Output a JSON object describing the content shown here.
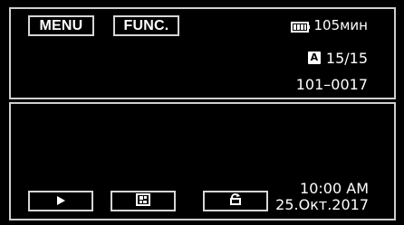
{
  "menu": {
    "label": "MENU"
  },
  "func": {
    "label": "FUNC."
  },
  "status": {
    "battery_icon": "battery-icon",
    "battery_time": "105мин",
    "mode_badge": "A",
    "count": "15/15",
    "file_number": "101–0017"
  },
  "controls": {
    "play_icon": "play-icon",
    "index_icon": "index-icon",
    "return_icon": "return-icon"
  },
  "datetime": {
    "time": "10:00 AM",
    "date": "25.Окт.2017"
  },
  "colors": {
    "background": "#000000",
    "border": "#d6d6d6",
    "text": "#ffffff"
  }
}
